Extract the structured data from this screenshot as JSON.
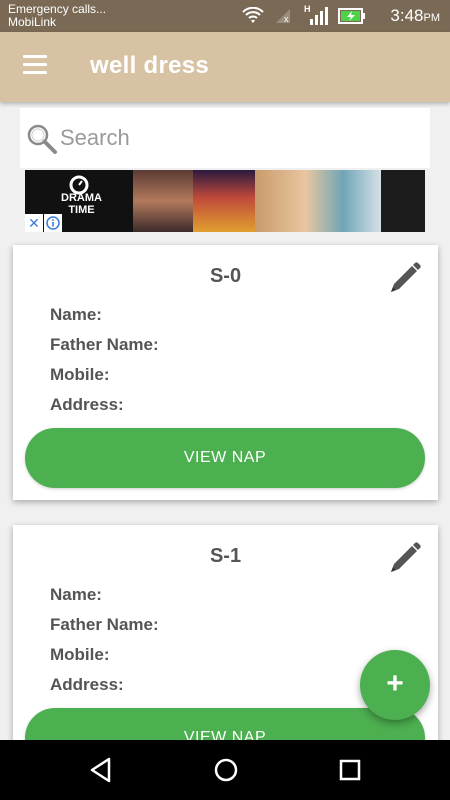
{
  "status_bar": {
    "carrier_line1": "Emergency calls...",
    "carrier_line2": "MobiLink",
    "time": "3:48",
    "time_suffix": "PM",
    "signal_label": "H",
    "secondary_signal_label": "x"
  },
  "app_bar": {
    "title": "well dress",
    "menu_icon": "hamburger-menu-icon"
  },
  "search": {
    "placeholder": "Search",
    "value": ""
  },
  "ad": {
    "logo_text_line1": "DRAMA",
    "logo_text_line2": "TIME",
    "close_label": "✕"
  },
  "cards": [
    {
      "title": "S-0",
      "name_label": "Name:",
      "father_label": "Father Name:",
      "mobile_label": "Mobile:",
      "address_label": "Address:",
      "button_label": "VIEW NAP"
    },
    {
      "title": "S-1",
      "name_label": "Name:",
      "father_label": "Father Name:",
      "mobile_label": "Mobile:",
      "address_label": "Address:",
      "button_label": "VIEW NAP"
    }
  ],
  "fab": {
    "label": "+"
  },
  "colors": {
    "accent_green": "#4caf50",
    "app_bar": "#d7c3a4",
    "status_bar": "#7a6a55"
  }
}
